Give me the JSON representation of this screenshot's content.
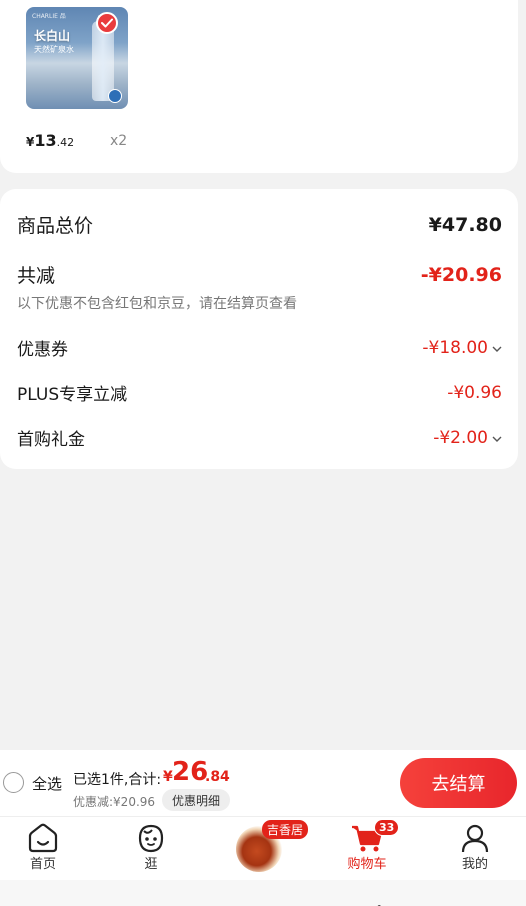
{
  "product": {
    "thumb_brand": "CHARLIE 品",
    "thumb_title": "长白山",
    "thumb_title2": "天然矿泉水",
    "price_symbol": "¥",
    "price_int": "13",
    "price_dec": ".42",
    "quantity": "x2"
  },
  "summary": {
    "total_label": "商品总价",
    "total_value": "¥47.80",
    "reduction_label": "共减",
    "reduction_value": "-¥20.96",
    "hint": "以下优惠不包含红包和京豆，请在结算页查看",
    "coupon_label": "优惠券",
    "coupon_value": "-¥18.00",
    "plus_label": "PLUS专享立减",
    "plus_value": "-¥0.96",
    "first_gift_label": "首购礼金",
    "first_gift_value": "-¥2.00"
  },
  "checkout": {
    "select_all": "全选",
    "selected_text": "已选1件,合计:",
    "total_symbol": "¥",
    "total_int": "26",
    "total_dec": ".84",
    "discount_text": "优惠减:¥20.96",
    "detail_button": "优惠明细",
    "checkout_button": "去结算"
  },
  "tabs": {
    "home": "首页",
    "browse": "逛",
    "promo_tag": "吉香居",
    "cart": "购物车",
    "cart_badge": "33",
    "mine": "我的"
  },
  "colors": {
    "accent": "#e2231a"
  }
}
